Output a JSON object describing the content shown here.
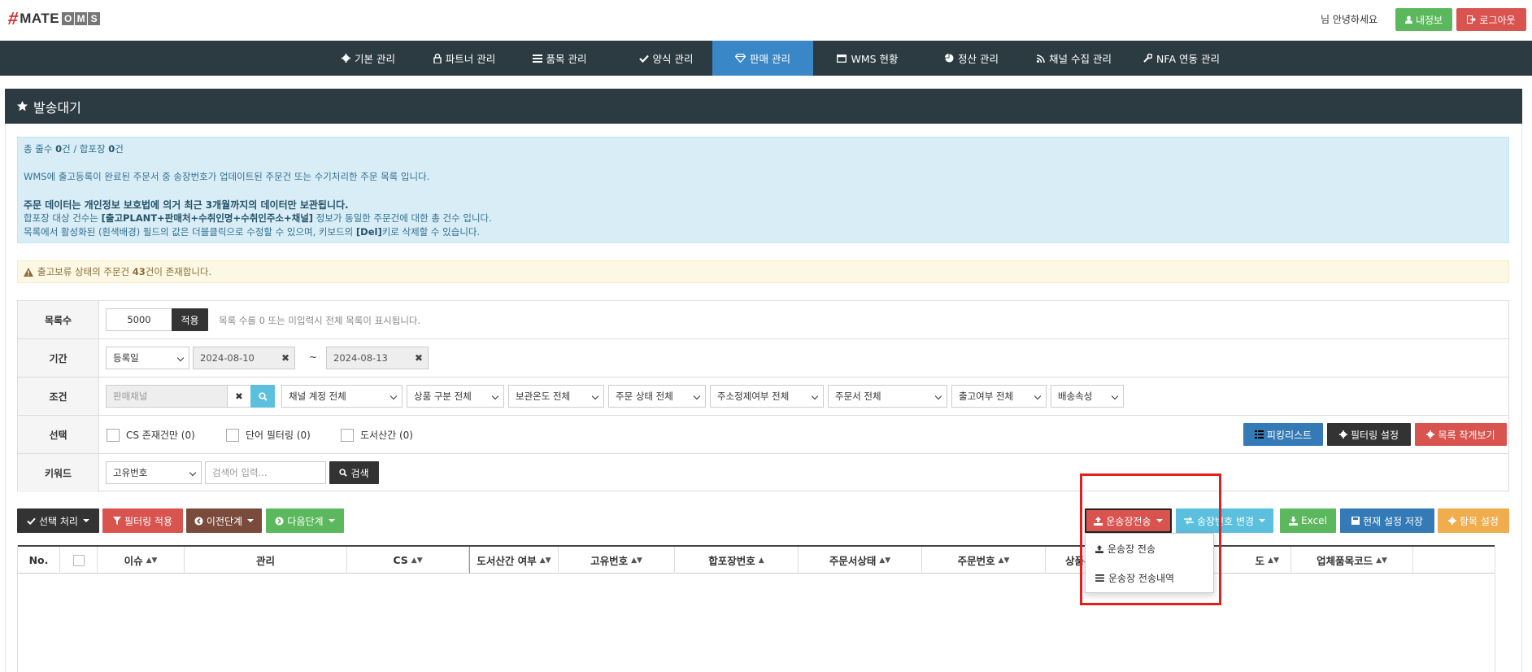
{
  "header": {
    "logo": {
      "hash": "#",
      "mate": "MATE",
      "oms": [
        "O",
        "M",
        "S"
      ]
    },
    "greeting": "님 안녕하세요",
    "myinfo_label": "내정보",
    "logout_label": "로그아웃"
  },
  "nav": [
    {
      "label": "기본 관리",
      "icon": "gear-icon"
    },
    {
      "label": "파트너 관리",
      "icon": "lock-icon"
    },
    {
      "label": "품목 관리",
      "icon": "list-icon"
    },
    {
      "label": "양식 관리",
      "icon": "check-icon"
    },
    {
      "label": "판매 관리",
      "icon": "diamond-icon",
      "active": true
    },
    {
      "label": "WMS 현황",
      "icon": "window-icon"
    },
    {
      "label": "정산 관리",
      "icon": "pie-icon"
    },
    {
      "label": "채널 수집 관리",
      "icon": "rss-icon"
    },
    {
      "label": "NFA 연동 관리",
      "icon": "wrench-icon"
    }
  ],
  "panel": {
    "title": "발송대기"
  },
  "info": {
    "count_prefix": "총 줄수 ",
    "count_total": "0",
    "count_mid": "건 / 합포장 ",
    "count_pack": "0",
    "count_suffix": "건",
    "line1": "WMS에 출고등록이 완료된 주문서 중 송장번호가 업데이트된 주문건 또는 수기처리한 주문 목록 입니다.",
    "line2": "주문 데이터는 개인정보 보호법에 의거 최근 3개월까지의 데이터만 보관됩니다.",
    "line3_a": "합포장 대상 건수는 ",
    "line3_b": "[출고PLANT+판매처+수취인명+수취인주소+채널]",
    "line3_c": " 정보가 동일한 주문건에 대한 총 건수 입니다.",
    "line4_a": "목록에서 활성화된 (흰색배경) 필드의 값은 더블클릭으로 수정할 수 있으며, 키보드의 ",
    "line4_b": "[Del]",
    "line4_c": "키로 삭제할 수 있습니다."
  },
  "warning": {
    "prefix": "출고보류 상태의 주문건 ",
    "count": "43",
    "suffix": "건이 존재합니다."
  },
  "filters": {
    "rows_label": "목록수",
    "rows_value": "5000",
    "apply_label": "적용",
    "rows_hint": "목록 수를 0 또는 미입력시 전체 목록이 표시됩니다.",
    "period_label": "기간",
    "period_type": "등록일",
    "date_from": "2024-08-10",
    "date_sep": "~",
    "date_to": "2024-08-13",
    "cond_label": "조건",
    "channel_placeholder": "판매채널",
    "selects": [
      "채널 계정 전체",
      "상품 구분 전체",
      "보관온도 전체",
      "주문 상태 전체",
      "주소정제여부 전체",
      "주문서 전체",
      "출고여부 전체",
      "배송속성"
    ],
    "select_label": "선택",
    "checks": [
      "CS 존재건만 (0)",
      "단어 필터링 (0)",
      "도서산간 (0)"
    ],
    "picking_label": "피킹리스트",
    "filter_setting_label": "필터링 설정",
    "list_small_label": "목록 작게보기",
    "keyword_label": "키워드",
    "keyword_type": "고유번호",
    "keyword_placeholder": "검색어 입력...",
    "search_label": "검색"
  },
  "actions": {
    "select_process": "선택 처리",
    "filter_apply": "필터링 적용",
    "prev_step": "이전단계",
    "next_step": "다음단계",
    "invoice_send": "운송장전송",
    "invoice_change": "송장번호 변경",
    "excel": "Excel",
    "save_settings": "현재 설정 저장",
    "column_settings": "항목 설정"
  },
  "dropdown": {
    "items": [
      "운송장 전송",
      "운송장 전송내역"
    ]
  },
  "grid": {
    "columns": [
      "No.",
      "",
      "이슈",
      "관리",
      "CS",
      "도서산간 여부",
      "고유번호",
      "합포장번호",
      "주문서상태",
      "주문번호",
      "상품주",
      "",
      "업체품목코드"
    ],
    "col_sort_partial": "도"
  },
  "colors": {
    "nav_bg": "#2c3a41",
    "nav_active": "#3a87c7",
    "danger": "#d9534f",
    "success": "#5cb85c",
    "primary": "#337ab7",
    "brown": "#7a4b3c",
    "warning": "#f0ad4e",
    "info": "#5bc0de",
    "highlight_border": "#e41e1e"
  }
}
